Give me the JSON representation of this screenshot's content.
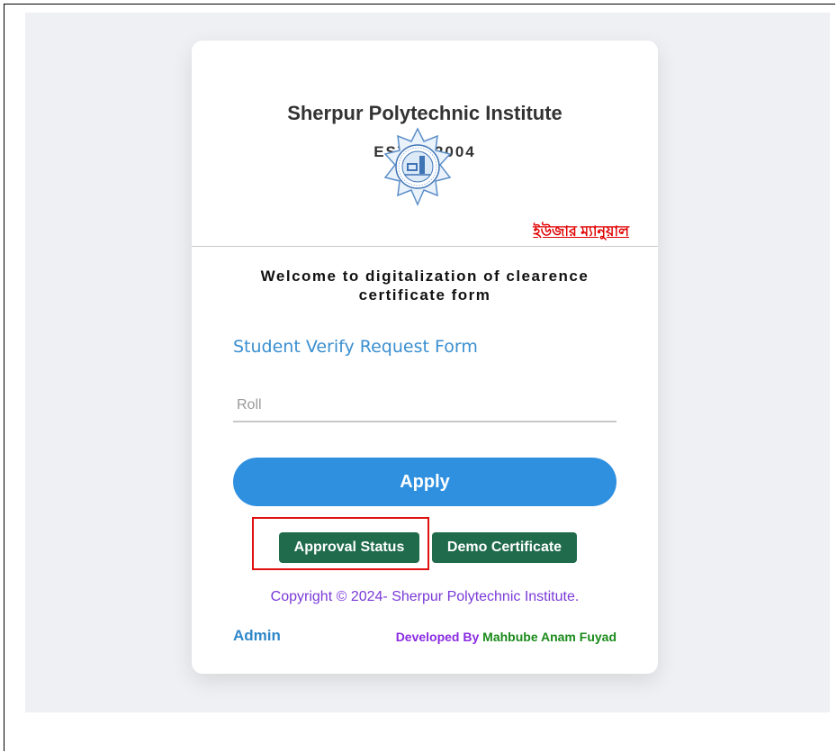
{
  "card": {
    "title": "Sherpur Polytechnic Institute",
    "estd": "ESTD: 2004",
    "logo_icon": "institute-seal-logo",
    "manual_link": "ইউজার ম্যানুয়াল"
  },
  "welcome": {
    "line1": "Welcome to digitalization of clearence",
    "line2": "certificate form"
  },
  "form": {
    "title": "Student Verify Request Form",
    "roll_placeholder": "Roll",
    "roll_value": "",
    "apply_label": "Apply"
  },
  "actions": {
    "approval_status": "Approval Status",
    "demo_certificate": "Demo Certificate"
  },
  "footer": {
    "copyright": "Copyright © 2024- Sherpur Polytechnic Institute.",
    "admin": "Admin",
    "developed_by": "Developed By",
    "developer_name": "Mahbube Anam Fuyad"
  },
  "colors": {
    "accent_blue": "#2f90e0",
    "green_button": "#1f6b4c",
    "manual_red": "#e00000",
    "highlight_red": "#e01010",
    "copyright_purple": "#7a3ad8"
  }
}
